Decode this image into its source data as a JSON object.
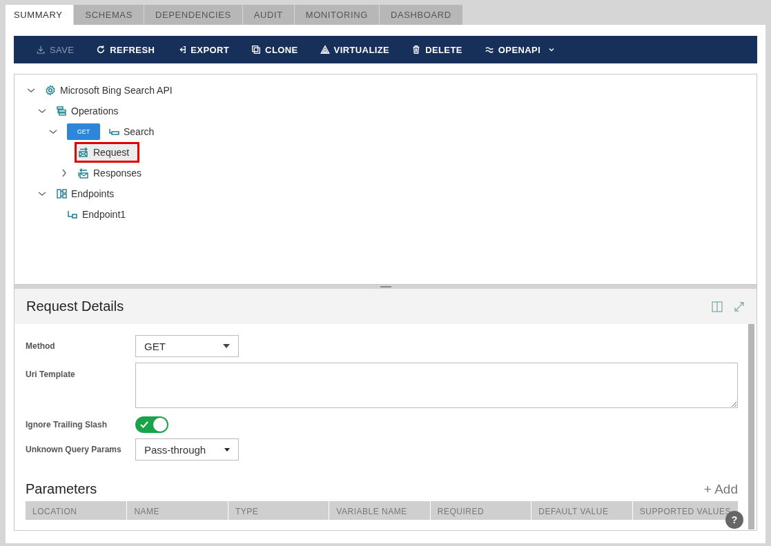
{
  "tabs": [
    {
      "label": "SUMMARY",
      "selected": true
    },
    {
      "label": "SCHEMAS",
      "selected": false
    },
    {
      "label": "DEPENDENCIES",
      "selected": false
    },
    {
      "label": "AUDIT",
      "selected": false
    },
    {
      "label": "MONITORING",
      "selected": false
    },
    {
      "label": "DASHBOARD",
      "selected": false
    }
  ],
  "toolbar": [
    {
      "kind": "save",
      "label": "SAVE",
      "disabled": true
    },
    {
      "kind": "refresh",
      "label": "REFRESH",
      "disabled": false
    },
    {
      "kind": "export",
      "label": "EXPORT",
      "disabled": false
    },
    {
      "kind": "clone",
      "label": "CLONE",
      "disabled": false
    },
    {
      "kind": "virtualize",
      "label": "VIRTUALIZE",
      "disabled": false
    },
    {
      "kind": "delete",
      "label": "DELETE",
      "disabled": false
    },
    {
      "kind": "openapi",
      "label": "OPENAPI",
      "disabled": false
    }
  ],
  "tree": [
    {
      "kind": "api",
      "label": "Microsoft Bing Search API",
      "expanded": true,
      "selected": false,
      "children": [
        {
          "kind": "operations",
          "label": "Operations",
          "expanded": true,
          "selected": false,
          "children": [
            {
              "kind": "operation",
              "badge": "GET",
              "label": "Search",
              "expanded": true,
              "selected": false,
              "children": [
                {
                  "kind": "request",
                  "label": "Request",
                  "selected": true
                },
                {
                  "kind": "responses",
                  "label": "Responses",
                  "expanded": false,
                  "selected": false
                }
              ]
            }
          ]
        },
        {
          "kind": "endpoints",
          "label": "Endpoints",
          "expanded": true,
          "selected": false,
          "children": [
            {
              "kind": "endpoint",
              "label": "Endpoint1",
              "selected": false
            }
          ]
        }
      ]
    }
  ],
  "details": {
    "title": "Request Details",
    "fields": [
      {
        "kind": "dropdown",
        "label": "Method",
        "value": "GET"
      },
      {
        "kind": "textarea",
        "label": "Uri Template"
      },
      {
        "kind": "toggle",
        "label": "Ignore Trailing Slash",
        "on": true
      },
      {
        "kind": "select",
        "label": "Unknown Query Params",
        "value": "Pass-through"
      }
    ]
  },
  "parameters": {
    "title": "Parameters",
    "add": "+ Add",
    "columns": [
      "LOCATION",
      "NAME",
      "TYPE",
      "VARIABLE NAME",
      "REQUIRED",
      "DEFAULT VALUE",
      "SUPPORTED VALUES"
    ]
  },
  "help": "?"
}
